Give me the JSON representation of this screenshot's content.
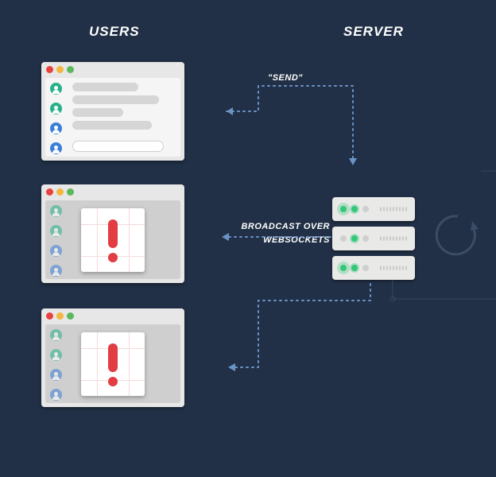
{
  "headings": {
    "users": "USERS",
    "server": "SERVER"
  },
  "labels": {
    "send": "\"SEND\"",
    "broadcast_line1": "BROADCAST OVER",
    "broadcast_line2": "WEBSOCKETS"
  },
  "colors": {
    "background": "#213046",
    "dotted_arrow": "#6a93c6",
    "error_red": "#e23d43",
    "led_green": "#34c77a",
    "avatar_green": "#27b18a",
    "avatar_blue": "#3d7fd6"
  },
  "browsers": [
    {
      "id": 1,
      "state": "active",
      "has_error": false
    },
    {
      "id": 2,
      "state": "dimmed",
      "has_error": true
    },
    {
      "id": 3,
      "state": "dimmed",
      "has_error": true
    }
  ],
  "server_racks": [
    {
      "leds": [
        "on-glow",
        "on",
        "off"
      ]
    },
    {
      "leds": [
        "off",
        "on",
        "off"
      ]
    },
    {
      "leds": [
        "on-glow",
        "on",
        "off"
      ]
    }
  ]
}
